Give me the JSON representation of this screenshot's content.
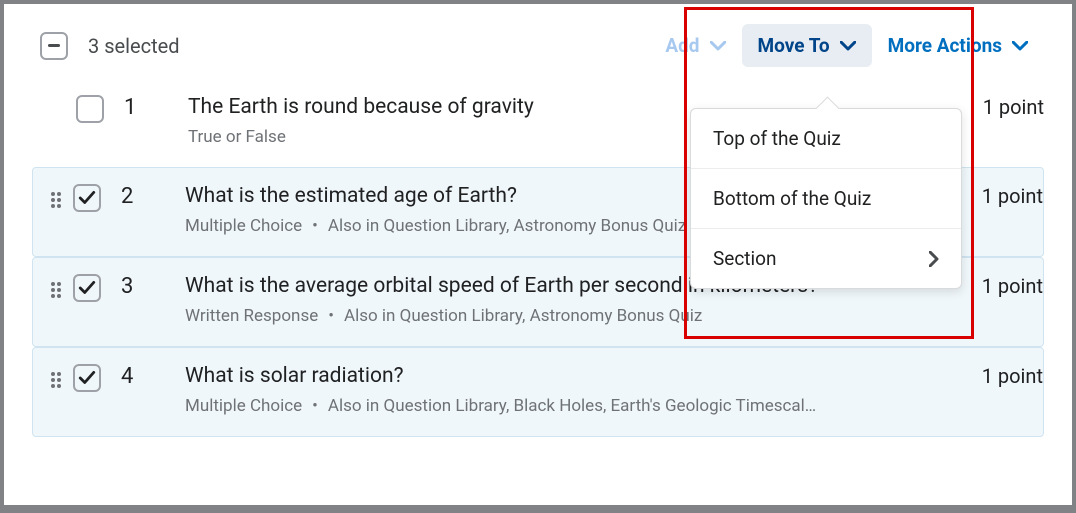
{
  "header": {
    "selected_text": "3 selected",
    "add_label": "Add",
    "move_label": "Move To",
    "more_label": "More Actions"
  },
  "dropdown": {
    "top": "Top of the Quiz",
    "bottom": "Bottom of the Quiz",
    "section": "Section"
  },
  "questions": [
    {
      "num": "1",
      "title": "The Earth is round because of gravity",
      "meta": "True or False",
      "meta2": "",
      "points": "1 point",
      "selected": false,
      "drag": false
    },
    {
      "num": "2",
      "title": "What is the estimated age of Earth?",
      "meta": "Multiple Choice",
      "meta2": "Also in Question Library, Astronomy Bonus Quiz",
      "points": "1 point",
      "selected": true,
      "drag": true
    },
    {
      "num": "3",
      "title": "What is the average orbital speed of Earth per second in kilometers?",
      "meta": "Written Response",
      "meta2": "Also in Question Library, Astronomy Bonus Quiz",
      "points": "1 point",
      "selected": true,
      "drag": true
    },
    {
      "num": "4",
      "title": "What is solar radiation?",
      "meta": "Multiple Choice",
      "meta2": "Also in Question Library, Black Holes, Earth's Geologic Timescal…",
      "points": "1 point",
      "selected": true,
      "drag": true
    }
  ]
}
